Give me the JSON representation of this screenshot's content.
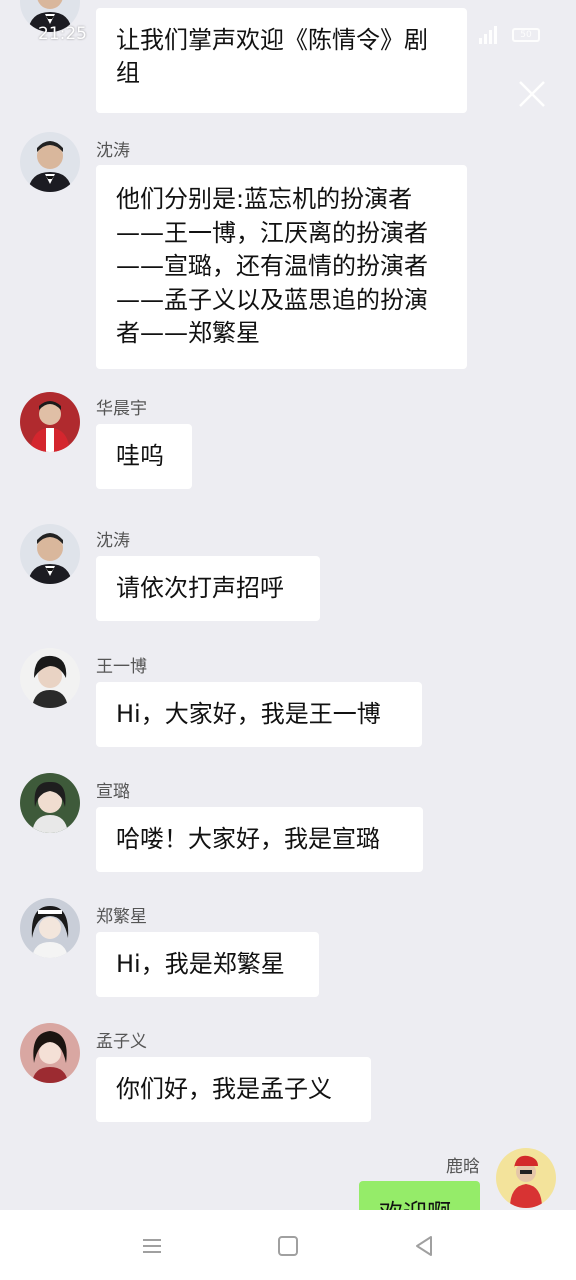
{
  "status_bar": {
    "time": "21:25",
    "battery": "50"
  },
  "messages": [
    {
      "sender": "",
      "text": "让我们掌声欢迎《陈情令》剧组",
      "side": "left",
      "avatar": "shen-tao-avatar"
    },
    {
      "sender": "沈涛",
      "text": "他们分别是:蓝忘机的扮演者——王一博，江厌离的扮演者——宣璐，还有温情的扮演者——孟子义以及蓝思追的扮演者——郑繁星",
      "side": "left",
      "avatar": "shen-tao-avatar"
    },
    {
      "sender": "华晨宇",
      "text": "哇呜",
      "side": "left",
      "avatar": "hua-chenyu-avatar"
    },
    {
      "sender": "沈涛",
      "text": "请依次打声招呼",
      "side": "left",
      "avatar": "shen-tao-avatar"
    },
    {
      "sender": "王一博",
      "text": "Hi，大家好，我是王一博",
      "side": "left",
      "avatar": "wang-yibo-avatar"
    },
    {
      "sender": "宣璐",
      "text": "哈喽！大家好，我是宣璐",
      "side": "left",
      "avatar": "xuan-lu-avatar"
    },
    {
      "sender": "郑繁星",
      "text": "Hi，我是郑繁星",
      "side": "left",
      "avatar": "zheng-fanxing-avatar"
    },
    {
      "sender": "孟子义",
      "text": "你们好，我是孟子义",
      "side": "left",
      "avatar": "meng-ziyi-avatar"
    },
    {
      "sender": "鹿晗",
      "text": "欢迎啊",
      "side": "right",
      "avatar": "lu-han-avatar"
    }
  ],
  "icons": {
    "close": "close-icon",
    "menu": "menu-icon",
    "home": "home-icon",
    "back": "back-icon"
  }
}
